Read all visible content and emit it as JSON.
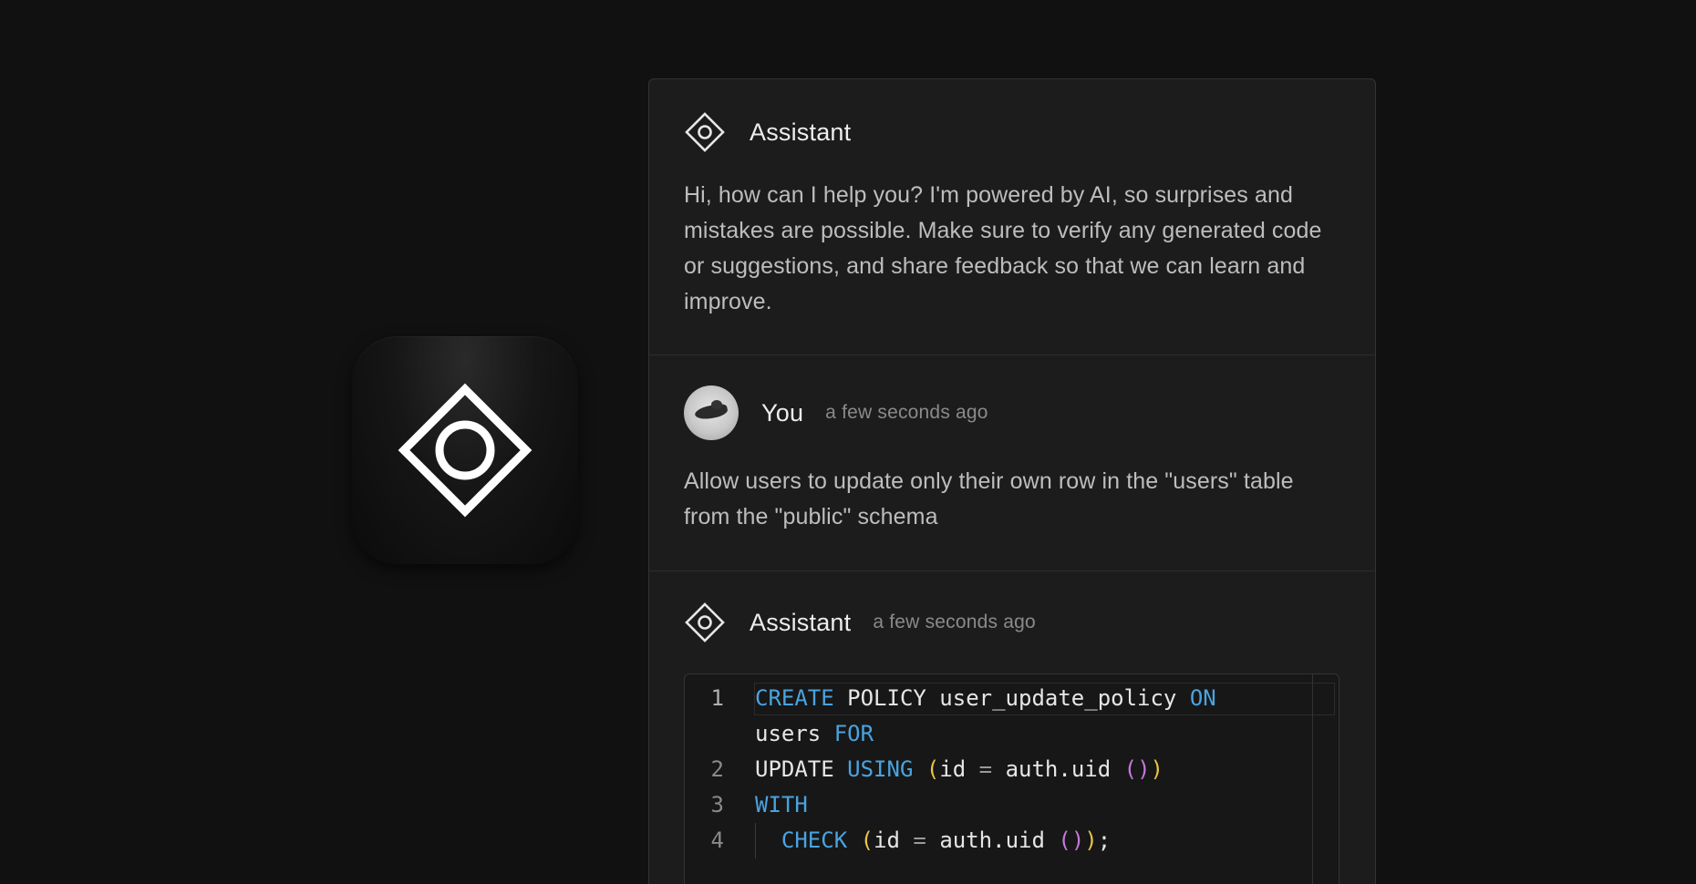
{
  "app_icon": {
    "icon": "diamond-ring-logo-icon"
  },
  "chat": {
    "messages": [
      {
        "author": "Assistant",
        "time": "",
        "text": "Hi, how can I help you? I'm powered by AI, so surprises and mistakes are possible. Make sure to verify any generated code or suggestions, and share feedback so that we can learn and improve."
      },
      {
        "author": "You",
        "time": "a few seconds ago",
        "text": "Allow users to update only their own row in the \"users\" table from the \"public\" schema"
      },
      {
        "author": "Assistant",
        "time": "a few seconds ago"
      }
    ],
    "code": {
      "language": "sql",
      "lines": [
        {
          "num": "1",
          "tokens": [
            [
              "kw",
              "CREATE"
            ],
            [
              "t",
              " POLICY user_update_policy "
            ],
            [
              "kw",
              "ON"
            ]
          ]
        },
        {
          "num": "",
          "tokens": [
            [
              "t",
              "users "
            ],
            [
              "kw",
              "FOR"
            ]
          ]
        },
        {
          "num": "2",
          "tokens": [
            [
              "t",
              "UPDATE "
            ],
            [
              "kw",
              "USING"
            ],
            [
              "t",
              " "
            ],
            [
              "par",
              "("
            ],
            [
              "t",
              "id "
            ],
            [
              "op",
              "="
            ],
            [
              "t",
              " auth.uid "
            ],
            [
              "par2",
              "()"
            ],
            [
              "par",
              ")"
            ]
          ]
        },
        {
          "num": "3",
          "tokens": [
            [
              "kw",
              "WITH"
            ]
          ]
        },
        {
          "num": "4",
          "tokens": [
            [
              "t",
              "  "
            ],
            [
              "kw",
              "CHECK"
            ],
            [
              "t",
              " "
            ],
            [
              "par",
              "("
            ],
            [
              "t",
              "id "
            ],
            [
              "op",
              "="
            ],
            [
              "t",
              " auth.uid "
            ],
            [
              "par2",
              "()"
            ],
            [
              "par",
              ")"
            ],
            [
              "t",
              ";"
            ]
          ]
        }
      ]
    }
  },
  "colors": {
    "background": "#111111",
    "panel": "#1c1c1c",
    "keyword": "#4aa3e0",
    "paren": "#e8c547",
    "paren_inner": "#c678dd"
  }
}
